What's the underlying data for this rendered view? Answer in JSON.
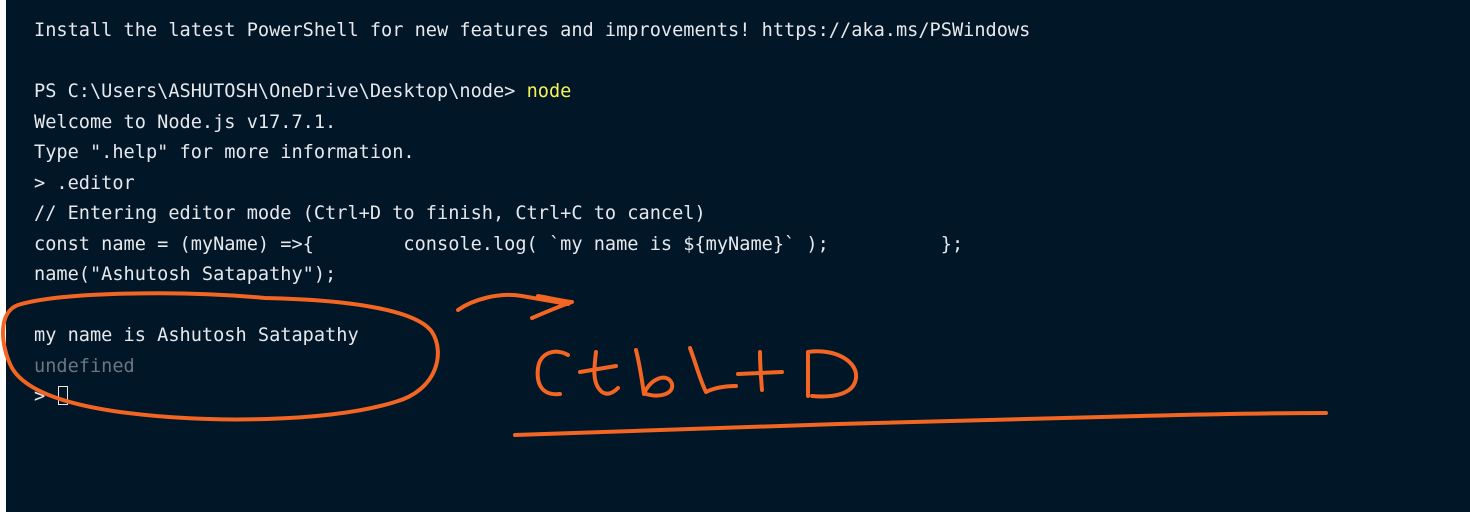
{
  "terminal": {
    "install_notice": "Install the latest PowerShell for new features and improvements! https://aka.ms/PSWindows",
    "prompt_path": "PS C:\\Users\\ASHUTOSH\\OneDrive\\Desktop\\node> ",
    "prompt_command": "node",
    "welcome": "Welcome to Node.js v17.7.1.",
    "help_hint": "Type \".help\" for more information.",
    "editor_cmd": "> .editor",
    "editor_mode": "// Entering editor mode (Ctrl+D to finish, Ctrl+C to cancel)",
    "code_line_1": "const name = (myName) =>{        console.log( `my name is ${myName}` );          };",
    "code_line_2": "name(\"Ashutosh Satapathy\");",
    "output": "my name is Ashutosh Satapathy",
    "return_value": "undefined",
    "prompt": "> "
  },
  "annotation": {
    "note": "Ctbl + D",
    "color": "#f26522"
  }
}
